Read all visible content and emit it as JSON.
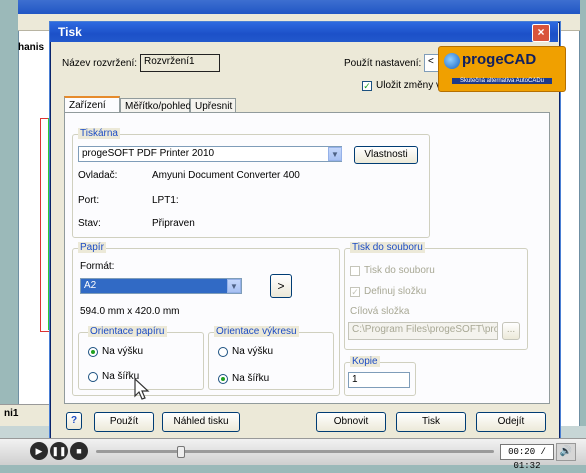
{
  "background_app": {
    "left_label": "hanis",
    "layout_tab": "ni1"
  },
  "dialog": {
    "title": "Tisk",
    "close_glyph": "×",
    "layout_name_label": "Název rozvržení:",
    "layout_name_value": "Rozvržení1",
    "use_settings_label": "Použít nastavení:",
    "use_settings_value": "<",
    "save_changes_label": "Uložit změny v r",
    "save_changes_checked": true,
    "logo_text": "progeCAD",
    "logo_sub": "Skutečná alternativa AutoCADu",
    "tabs": [
      "Zařízení",
      "Měřítko/pohled",
      "Upřesnit"
    ],
    "active_tab": 0,
    "printer_group": {
      "title": "Tiskárna",
      "printer_value": "progeSOFT PDF Printer 2010",
      "properties_button": "Vlastnosti",
      "driver_label": "Ovladač:",
      "driver_value": "Amyuni Document Converter 400",
      "port_label": "Port:",
      "port_value": "LPT1:",
      "status_label": "Stav:",
      "status_value": "Připraven"
    },
    "paper_group": {
      "title": "Papír",
      "format_label": "Formát:",
      "format_value": "A2",
      "size_text": "594.0 mm x 420.0 mm",
      "paper_orientation_title": "Orientace papíru",
      "paper_portrait": "Na výšku",
      "paper_landscape": "Na šířku",
      "paper_orientation_selected": "portrait",
      "drawing_orientation_title": "Orientace výkresu",
      "drawing_portrait": "Na výšku",
      "drawing_landscape": "Na šířku",
      "drawing_orientation_selected": "landscape"
    },
    "file_group": {
      "title": "Tisk do souboru",
      "print_to_file": "Tisk do souboru",
      "define_folder": "Definuj složku",
      "target_folder_label": "Cílová složka",
      "target_folder_value": "C:\\Program Files\\progeSOFT\\pro",
      "browse_button": "..."
    },
    "copies_group": {
      "title": "Kopie",
      "value": "1"
    },
    "footer": {
      "help": "?",
      "apply": "Použít",
      "preview": "Náhled tisku",
      "refresh": "Obnovit",
      "print": "Tisk",
      "cancel": "Odejít"
    }
  },
  "player": {
    "time": "00:20 / 01:32",
    "progress": 0.21
  },
  "colors": {
    "titlebar": "#1c50c8",
    "group_title": "#1c4cc4",
    "selection": "#316ac5",
    "logo": "#f0a000"
  }
}
